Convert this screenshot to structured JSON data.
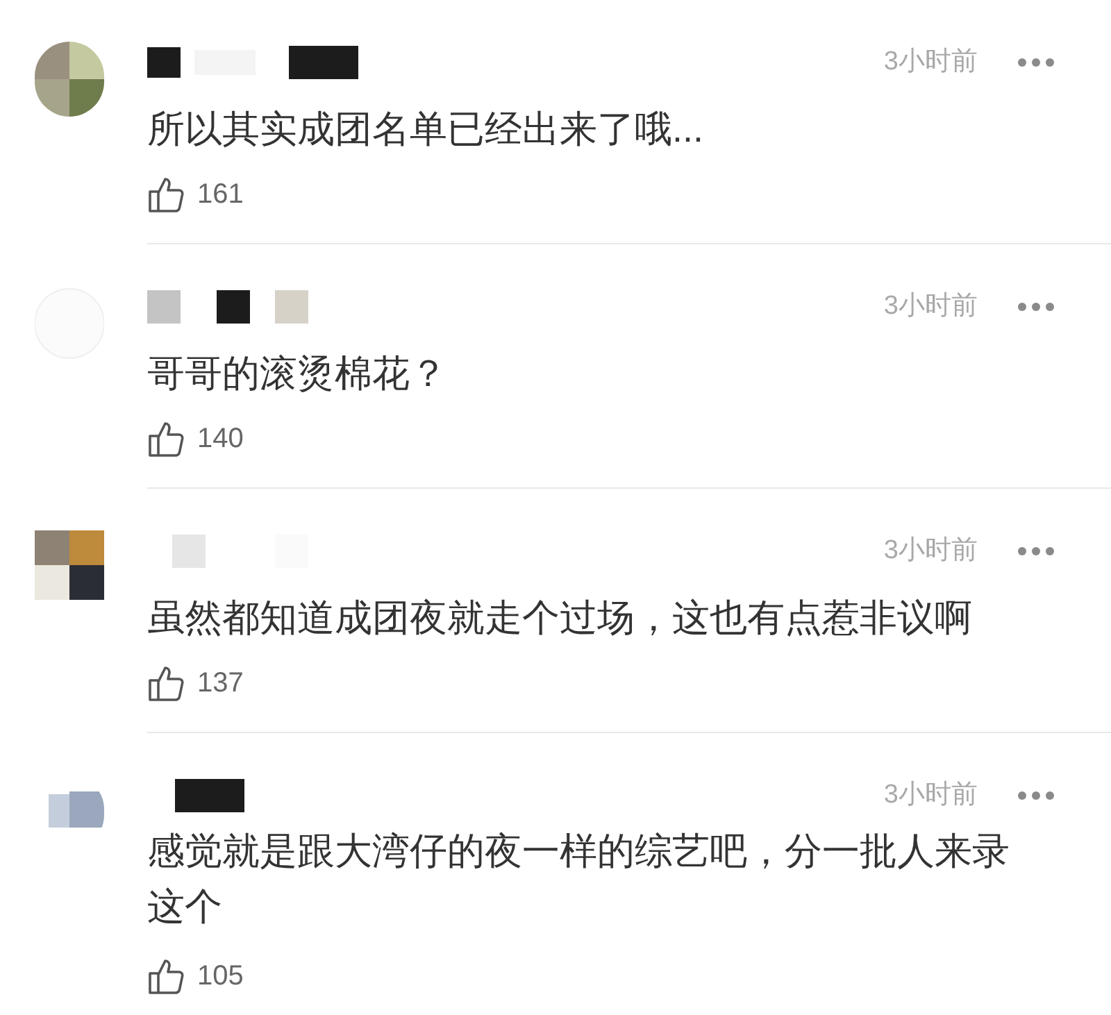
{
  "comments": [
    {
      "name_redacted": true,
      "time": "3小时前",
      "text": "所以其实成团名单已经出来了哦...",
      "likes": "161"
    },
    {
      "name_redacted": true,
      "time": "3小时前",
      "text": "哥哥的滚烫棉花？",
      "likes": "140"
    },
    {
      "name_redacted": true,
      "time": "3小时前",
      "text": "虽然都知道成团夜就走个过场，这也有点惹非议啊",
      "likes": "137"
    },
    {
      "name_redacted": true,
      "time": "3小时前",
      "text": "感觉就是跟大湾仔的夜一样的综艺吧，分一批人来录这个",
      "likes": "105"
    }
  ]
}
